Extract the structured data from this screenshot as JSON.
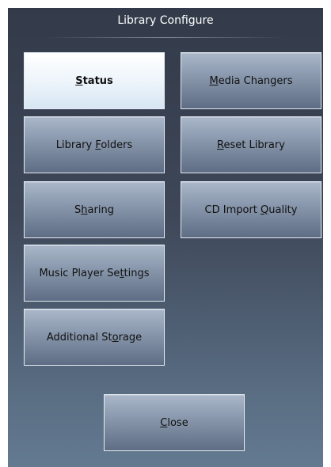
{
  "dialog": {
    "title": "Library Configure"
  },
  "buttons": {
    "status": {
      "pre": "",
      "key": "S",
      "post": "tatus"
    },
    "media_changers": {
      "pre": "",
      "key": "M",
      "post": "edia Changers"
    },
    "library_folders": {
      "pre": "Library ",
      "key": "F",
      "post": "olders"
    },
    "reset_library": {
      "pre": "",
      "key": "R",
      "post": "eset Library"
    },
    "sharing": {
      "pre": "S",
      "key": "h",
      "post": "aring"
    },
    "cd_import": {
      "pre": "CD Import ",
      "key": "Q",
      "post": "uality"
    },
    "music_player": {
      "pre": "Music Player Se",
      "key": "t",
      "post": "tings"
    },
    "additional": {
      "pre": "Additional St",
      "key": "o",
      "post": "rage"
    },
    "close": {
      "pre": "",
      "key": "C",
      "post": "lose"
    }
  },
  "selected_button": "Status"
}
